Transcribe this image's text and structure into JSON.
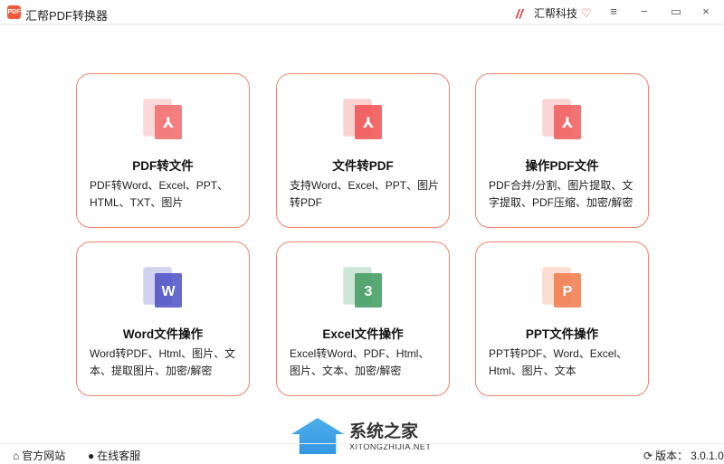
{
  "app": {
    "title": "汇帮PDF转换器",
    "logo_text": "PDF",
    "brand": "汇帮科技"
  },
  "window": {
    "menu": "≡",
    "minimize": "−",
    "maximize": "▭",
    "close": "×"
  },
  "cards": [
    {
      "title": "PDF转文件",
      "desc": "PDF转Word、Excel、PPT、HTML、TXT、图片",
      "color": "#f06a6a",
      "icon": "pdf-to-file-icon"
    },
    {
      "title": "文件转PDF",
      "desc": "支持Word、Excel、PPT、图片转PDF",
      "color": "#f05050",
      "icon": "file-to-pdf-icon"
    },
    {
      "title": "操作PDF文件",
      "desc": "PDF合并/分割、图片提取、文字提取、PDF压缩、加密/解密",
      "color": "#f05a5a",
      "icon": "pdf-operate-icon"
    },
    {
      "title": "Word文件操作",
      "desc": "Word转PDF、Html、图片、文本、提取图片、加密/解密",
      "color": "#4b4fc4",
      "icon": "word-icon"
    },
    {
      "title": "Excel文件操作",
      "desc": "Excel转Word、PDF、Html、图片、文本、加密/解密",
      "color": "#3e9a5e",
      "icon": "excel-icon"
    },
    {
      "title": "PPT文件操作",
      "desc": "PPT转PDF、Word、Excel、Html、图片、文本",
      "color": "#f07a4a",
      "icon": "ppt-icon"
    }
  ],
  "footer": {
    "website": "官方网站",
    "service": "在线客服",
    "version_label": "版本：",
    "version": "3.0.1.0"
  },
  "watermark": {
    "title": "系统之家",
    "sub": "XITONGZHIJIA.NET"
  }
}
